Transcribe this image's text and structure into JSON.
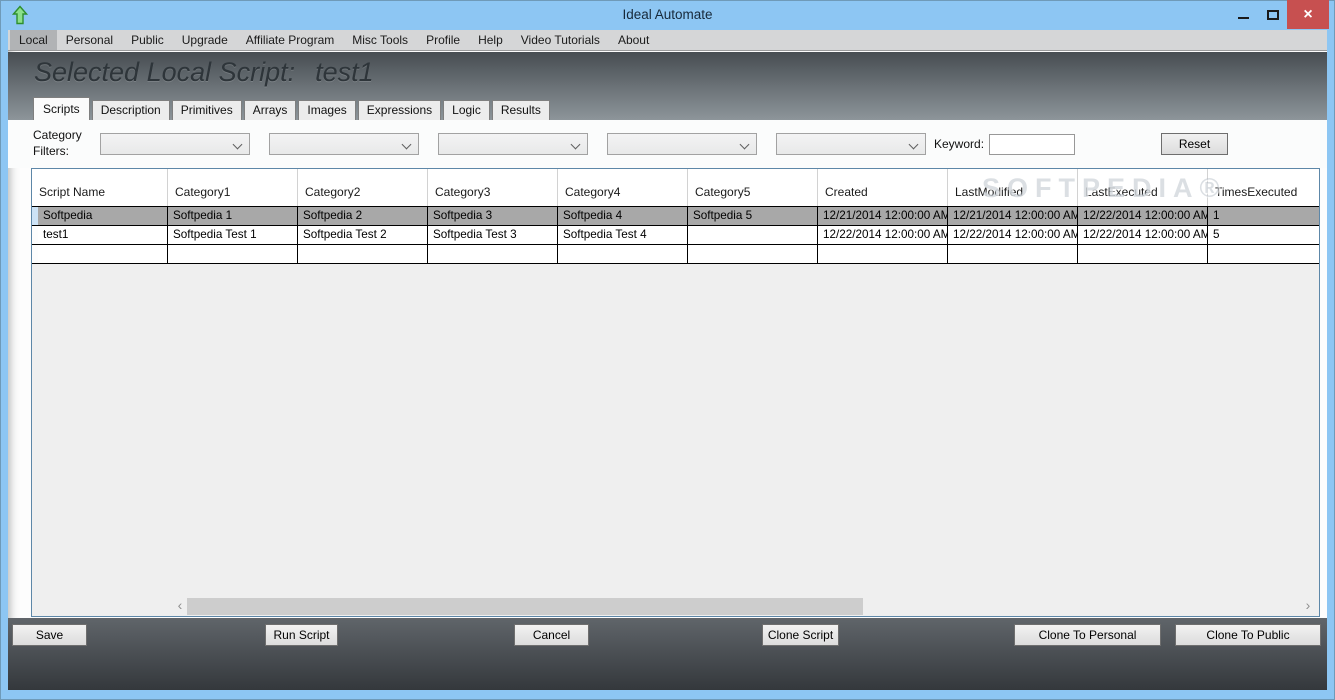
{
  "window": {
    "title": "Ideal Automate"
  },
  "icons": {
    "app": "green-up-arrow-icon",
    "minimize": "minimize-icon",
    "maximize": "maximize-icon",
    "close": "close-icon",
    "dropdown": "chevron-down-icon",
    "scroll_left": "chevron-left-icon",
    "scroll_right": "chevron-right-icon"
  },
  "menubar": {
    "active": "Local",
    "items": [
      "Local",
      "Personal",
      "Public",
      "Upgrade",
      "Affiliate Program",
      "Misc Tools",
      "Profile",
      "Help",
      "Video Tutorials",
      "About"
    ]
  },
  "header": {
    "label": "Selected Local Script:",
    "script_name": "test1"
  },
  "tabs": [
    "Scripts",
    "Description",
    "Primitives",
    "Arrays",
    "Images",
    "Expressions",
    "Logic",
    "Results"
  ],
  "filters": {
    "category_label": "Category Filters:",
    "dropdown_values": [
      "",
      "",
      "",
      "",
      ""
    ],
    "keyword_label": "Keyword:",
    "keyword_value": "",
    "reset_label": "Reset"
  },
  "grid": {
    "columns": [
      "Script Name",
      "Category1",
      "Category2",
      "Category3",
      "Category4",
      "Category5",
      "Created",
      "LastModified",
      "LastExecuted",
      "TimesExecuted"
    ],
    "rows": [
      {
        "selected": true,
        "cells": [
          "Softpedia",
          "Softpedia 1",
          "Softpedia 2",
          "Softpedia 3",
          "Softpedia 4",
          "Softpedia 5",
          "12/21/2014 12:00:00 AM",
          "12/21/2014 12:00:00 AM",
          "12/22/2014 12:00:00 AM",
          "1"
        ]
      },
      {
        "selected": false,
        "cells": [
          "test1",
          "Softpedia Test 1",
          "Softpedia Test 2",
          "Softpedia Test 3",
          "Softpedia Test 4",
          "",
          "12/22/2014 12:00:00 AM",
          "12/22/2014 12:00:00 AM",
          "12/22/2014 12:00:00 AM",
          "5"
        ]
      },
      {
        "selected": false,
        "cells": [
          "",
          "",
          "",
          "",
          "",
          "",
          "",
          "",
          "",
          ""
        ]
      }
    ]
  },
  "watermark": "SOFTPEDIA®",
  "buttons": {
    "save": "Save",
    "run_script": "Run Script",
    "cancel": "Cancel",
    "clone_script": "Clone Script",
    "clone_to_personal": "Clone To Personal",
    "clone_to_public": "Clone To Public"
  },
  "scrollbar": {
    "left_arrow": "‹",
    "right_arrow": "›"
  },
  "colors": {
    "titlebar_blue": "#8dc6f3",
    "close_red": "#c75050",
    "selected_row_gray": "#a8a8a8",
    "grid_border_blue": "#5d87a8",
    "header_gradient_top": "#474d52",
    "header_gradient_bottom": "#8d959a"
  }
}
